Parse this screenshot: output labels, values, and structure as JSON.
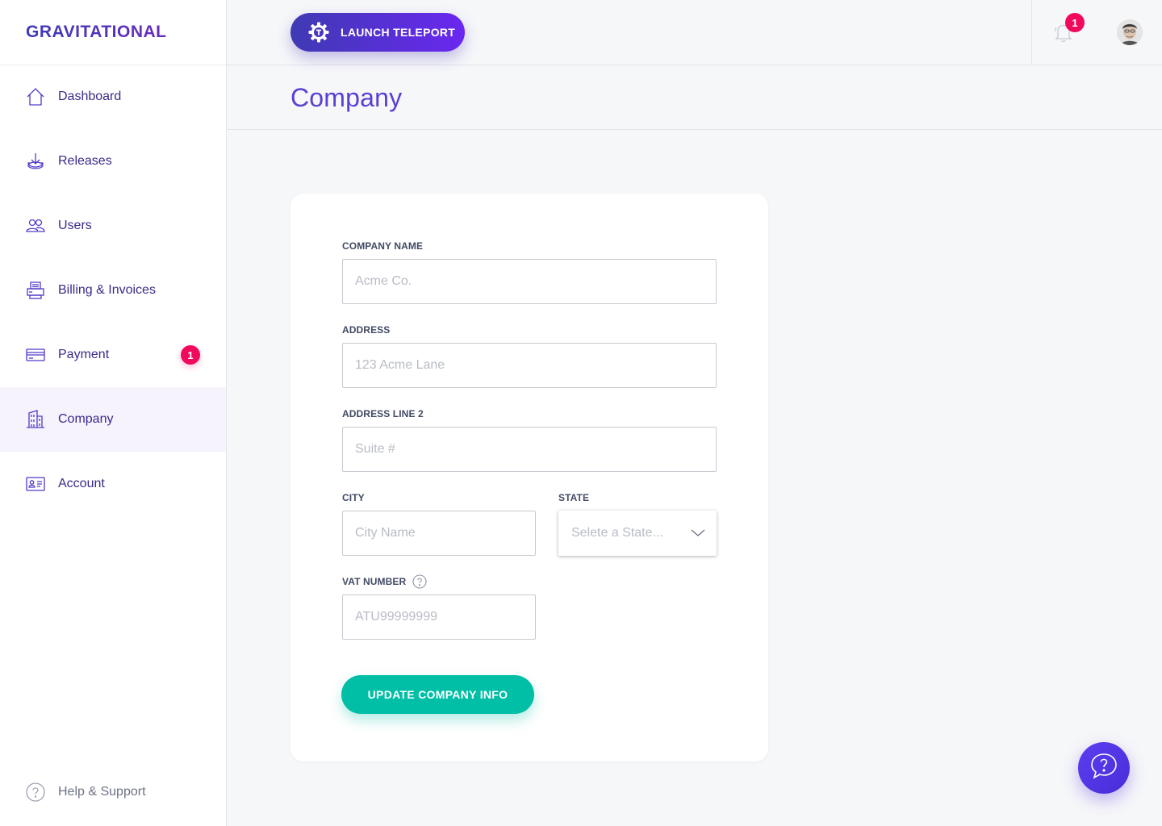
{
  "brand": {
    "logo": "GRAVITATIONAL"
  },
  "sidebar": {
    "items": [
      {
        "label": "Dashboard",
        "icon": "home-icon"
      },
      {
        "label": "Releases",
        "icon": "download-icon"
      },
      {
        "label": "Users",
        "icon": "users-icon"
      },
      {
        "label": "Billing & Invoices",
        "icon": "printer-icon"
      },
      {
        "label": "Payment",
        "icon": "credit-card-icon",
        "badge": "1"
      },
      {
        "label": "Company",
        "icon": "building-icon",
        "active": true
      },
      {
        "label": "Account",
        "icon": "id-card-icon"
      }
    ],
    "help": {
      "label": "Help & Support",
      "icon": "help-circle-icon"
    }
  },
  "topbar": {
    "launch_label": "LAUNCH TELEPORT",
    "notifications_badge": "1"
  },
  "page": {
    "title": "Company"
  },
  "form": {
    "company_name": {
      "label": "COMPANY NAME",
      "placeholder": "Acme Co.",
      "value": ""
    },
    "address": {
      "label": "ADDRESS",
      "placeholder": "123 Acme Lane",
      "value": ""
    },
    "address2": {
      "label": "ADDRESS LINE 2",
      "placeholder": "Suite #",
      "value": ""
    },
    "city": {
      "label": "CITY",
      "placeholder": "City Name",
      "value": ""
    },
    "state": {
      "label": "STATE",
      "placeholder": "Selete a State..."
    },
    "vat": {
      "label": "VAT NUMBER",
      "placeholder": "ATU99999999",
      "value": ""
    },
    "submit_label": "UPDATE COMPANY INFO"
  },
  "colors": {
    "primary": "#5a3fd3",
    "nav_text": "#3b2a8a",
    "badge": "#f0095c",
    "submit": "#00bfa6"
  }
}
